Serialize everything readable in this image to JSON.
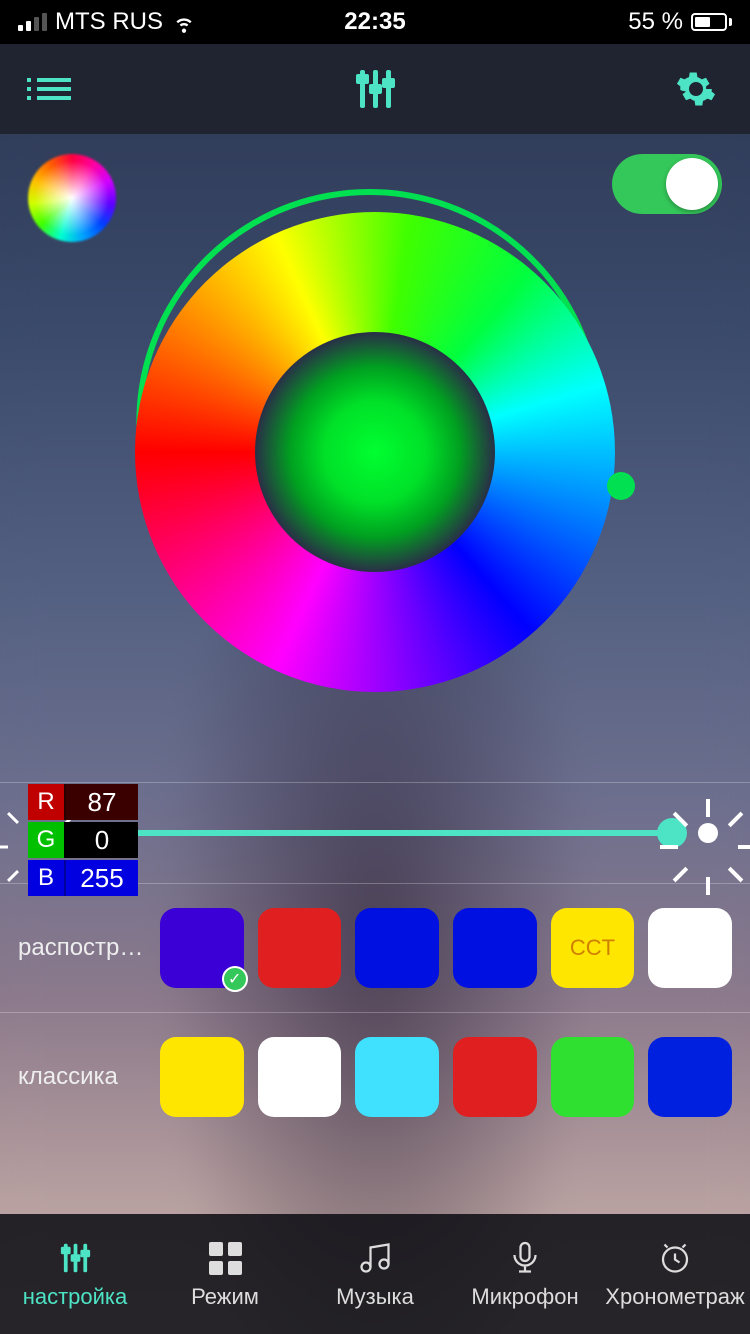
{
  "status": {
    "carrier": "MTS RUS",
    "time": "22:35",
    "battery_pct": "55 %"
  },
  "toolbar": {
    "list": "list-icon",
    "sliders": "sliders-icon",
    "gear": "gear-icon"
  },
  "controls": {
    "power_on": true
  },
  "rgb": {
    "r_label": "R",
    "r_val": "87",
    "g_label": "G",
    "g_val": "0",
    "b_label": "B",
    "b_val": "255"
  },
  "brightness": {
    "value": 100
  },
  "presets": {
    "row1_label": "распостра...",
    "row1_colors": [
      "#3a00d6",
      "#e02020",
      "#0010e0",
      "#0010e0",
      "#ffe600",
      "#ffffff"
    ],
    "row1_cct_index": 4,
    "row1_cct_text": "CCT",
    "row1_selected": 0,
    "row2_label": "классика",
    "row2_colors": [
      "#ffe600",
      "#ffffff",
      "#40e0ff",
      "#e02020",
      "#30e030",
      "#0020e0"
    ]
  },
  "nav": {
    "items": [
      {
        "label": "настройка",
        "icon": "sliders",
        "active": true
      },
      {
        "label": "Режим",
        "icon": "grid"
      },
      {
        "label": "Музыка",
        "icon": "music"
      },
      {
        "label": "Микрофон",
        "icon": "mic"
      },
      {
        "label": "Хронометраж",
        "icon": "clock"
      }
    ]
  }
}
